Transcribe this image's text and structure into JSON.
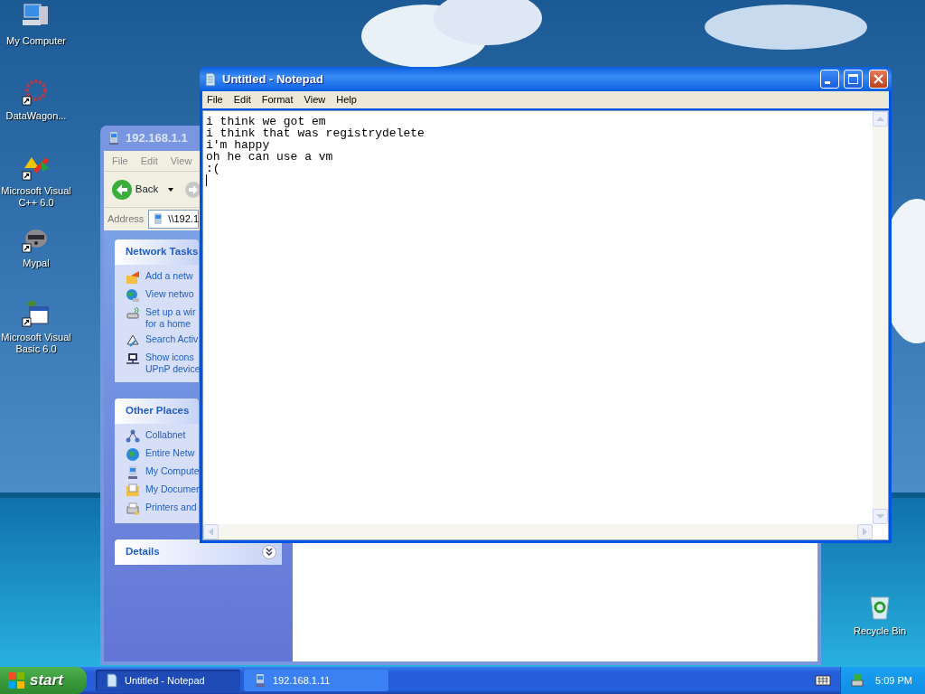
{
  "desktop_icons": [
    {
      "label": "My Computer",
      "shortcut": false
    },
    {
      "label": "DataWagon...",
      "shortcut": true
    },
    {
      "label": "Microsoft Visual C++ 6.0",
      "shortcut": true
    },
    {
      "label": "Mypal",
      "shortcut": true
    },
    {
      "label": "Microsoft Visual Basic 6.0",
      "shortcut": true
    },
    {
      "label": "Recycle Bin",
      "shortcut": false
    }
  ],
  "explorer": {
    "title": "192.168.1.1",
    "menu": [
      "File",
      "Edit",
      "View"
    ],
    "back_label": "Back",
    "address_label": "Address",
    "address_value": "\\\\192.1",
    "panels": [
      {
        "title": "Network Tasks",
        "items": [
          "Add a netw",
          "View netwo",
          "Set up a wir\nfor a home",
          "Search Activ",
          "Show icons\nUPnP device"
        ]
      },
      {
        "title": "Other Places",
        "items": [
          "Collabnet",
          "Entire Netw",
          "My Compute",
          "My Documen",
          "Printers and"
        ]
      },
      {
        "title": "Details",
        "collapsed": true
      }
    ]
  },
  "notepad": {
    "title": "Untitled - Notepad",
    "menu": [
      "File",
      "Edit",
      "Format",
      "View",
      "Help"
    ],
    "lines": [
      "i think we got em",
      "i think that was registrydelete",
      "i'm happy",
      "oh he can use a vm",
      ":("
    ]
  },
  "taskbar": {
    "start": "start",
    "tasks": [
      {
        "label": "Untitled - Notepad",
        "selected": true
      },
      {
        "label": "192.168.1.11",
        "selected": false
      }
    ],
    "clock": "5:09 PM"
  }
}
